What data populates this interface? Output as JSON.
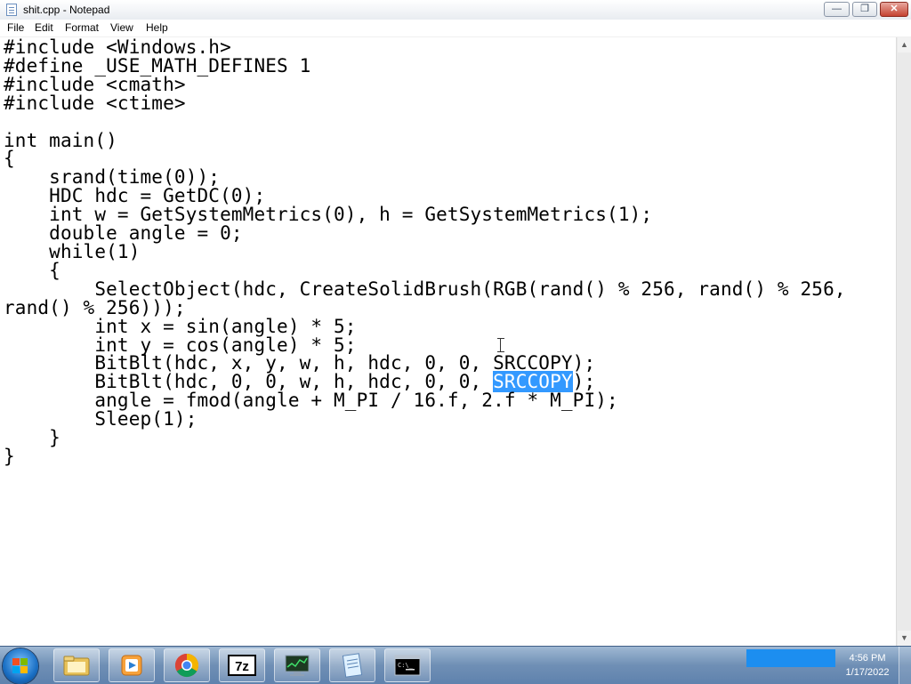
{
  "window": {
    "title": "shit.cpp - Notepad",
    "controls": {
      "minimize": "—",
      "maximize": "❐",
      "close": "✕"
    }
  },
  "menu": {
    "file": "File",
    "edit": "Edit",
    "format": "Format",
    "view": "View",
    "help": "Help"
  },
  "editor": {
    "lines": [
      "#include <Windows.h>",
      "#define _USE_MATH_DEFINES 1",
      "#include <cmath>",
      "#include <ctime>",
      "",
      "int main()",
      "{",
      "    srand(time(0));",
      "    HDC hdc = GetDC(0);",
      "    int w = GetSystemMetrics(0), h = GetSystemMetrics(1);",
      "    double angle = 0;",
      "    while(1)",
      "    {",
      "        SelectObject(hdc, CreateSolidBrush(RGB(rand() % 256, rand() % 256,",
      "rand() % 256)));",
      "        int x = sin(angle) * 5;",
      "        int y = cos(angle) * 5;",
      "        BitBlt(hdc, x, y, w, h, hdc, 0, 0, SRCCOPY);",
      "        BitBlt(hdc, 0, 0, w, h, hdc, 0, 0, ",
      "        angle = fmod(angle + M_PI / 16.f, 2.f * M_PI);",
      "        Sleep(1);",
      "    }",
      "}"
    ],
    "selected_line_index": 18,
    "selected_text": "SRCCOPY",
    "after_selection": ");"
  },
  "taskbar": {
    "icons": [
      "start-orb-icon",
      "file-explorer-icon",
      "media-player-icon",
      "chrome-icon",
      "7zip-icon",
      "task-manager-icon",
      "notepad-icon",
      "command-prompt-icon"
    ],
    "clock_time": "4:56 PM",
    "clock_date": "1/17/2022"
  },
  "colors": {
    "selection": "#3399ff",
    "taskbar": "#6f8fb5"
  }
}
